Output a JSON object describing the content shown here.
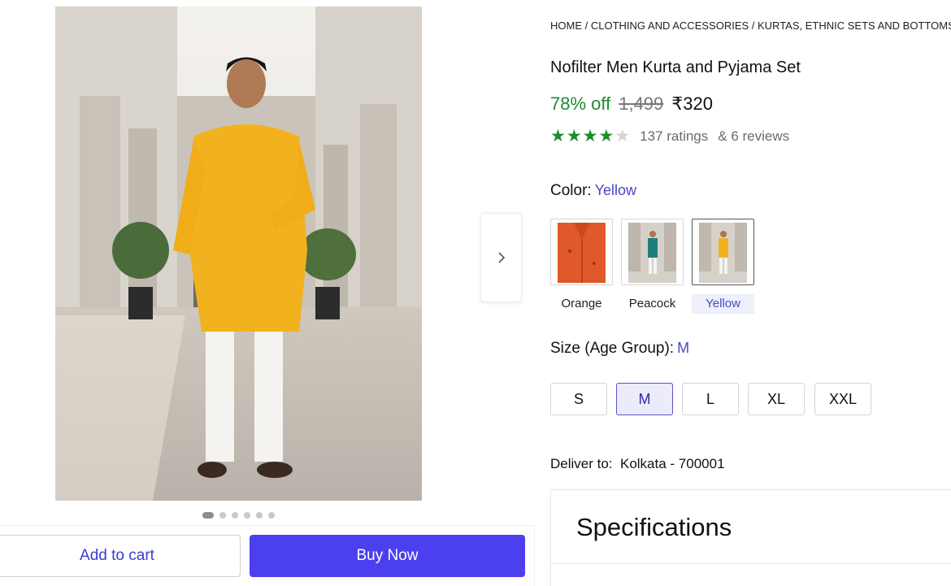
{
  "breadcrumb": "HOME / CLOTHING AND ACCESSORIES / KURTAS, ETHNIC SETS AND BOTTOMS / I",
  "product": {
    "title": "Nofilter Men Kurta and Pyjama Set",
    "discount": "78% off",
    "mrp": "1,499",
    "price": "₹320",
    "rating_value": 4,
    "rating_max": 5,
    "ratings_text": "137 ratings",
    "reviews_text": "& 6 reviews"
  },
  "color": {
    "label": "Color:",
    "selected": "Yellow",
    "options": [
      "Orange",
      "Peacock",
      "Yellow"
    ]
  },
  "size": {
    "label": "Size (Age Group):",
    "selected": "M",
    "options": [
      "S",
      "M",
      "L",
      "XL",
      "XXL"
    ]
  },
  "delivery": {
    "label": "Deliver to:",
    "location": "Kolkata - 700001"
  },
  "specifications": {
    "title": "Specifications"
  },
  "actions": {
    "add_to_cart": "Add to cart",
    "buy_now": "Buy Now"
  },
  "carousel": {
    "slide_count": 6,
    "active_slide": 1
  },
  "colors": {
    "accent": "#4b3ff0",
    "discount_green": "#1e8b2e",
    "star_green": "#1e8b2e"
  },
  "icons": {
    "next": "chevron-right-icon",
    "star": "star-icon"
  }
}
